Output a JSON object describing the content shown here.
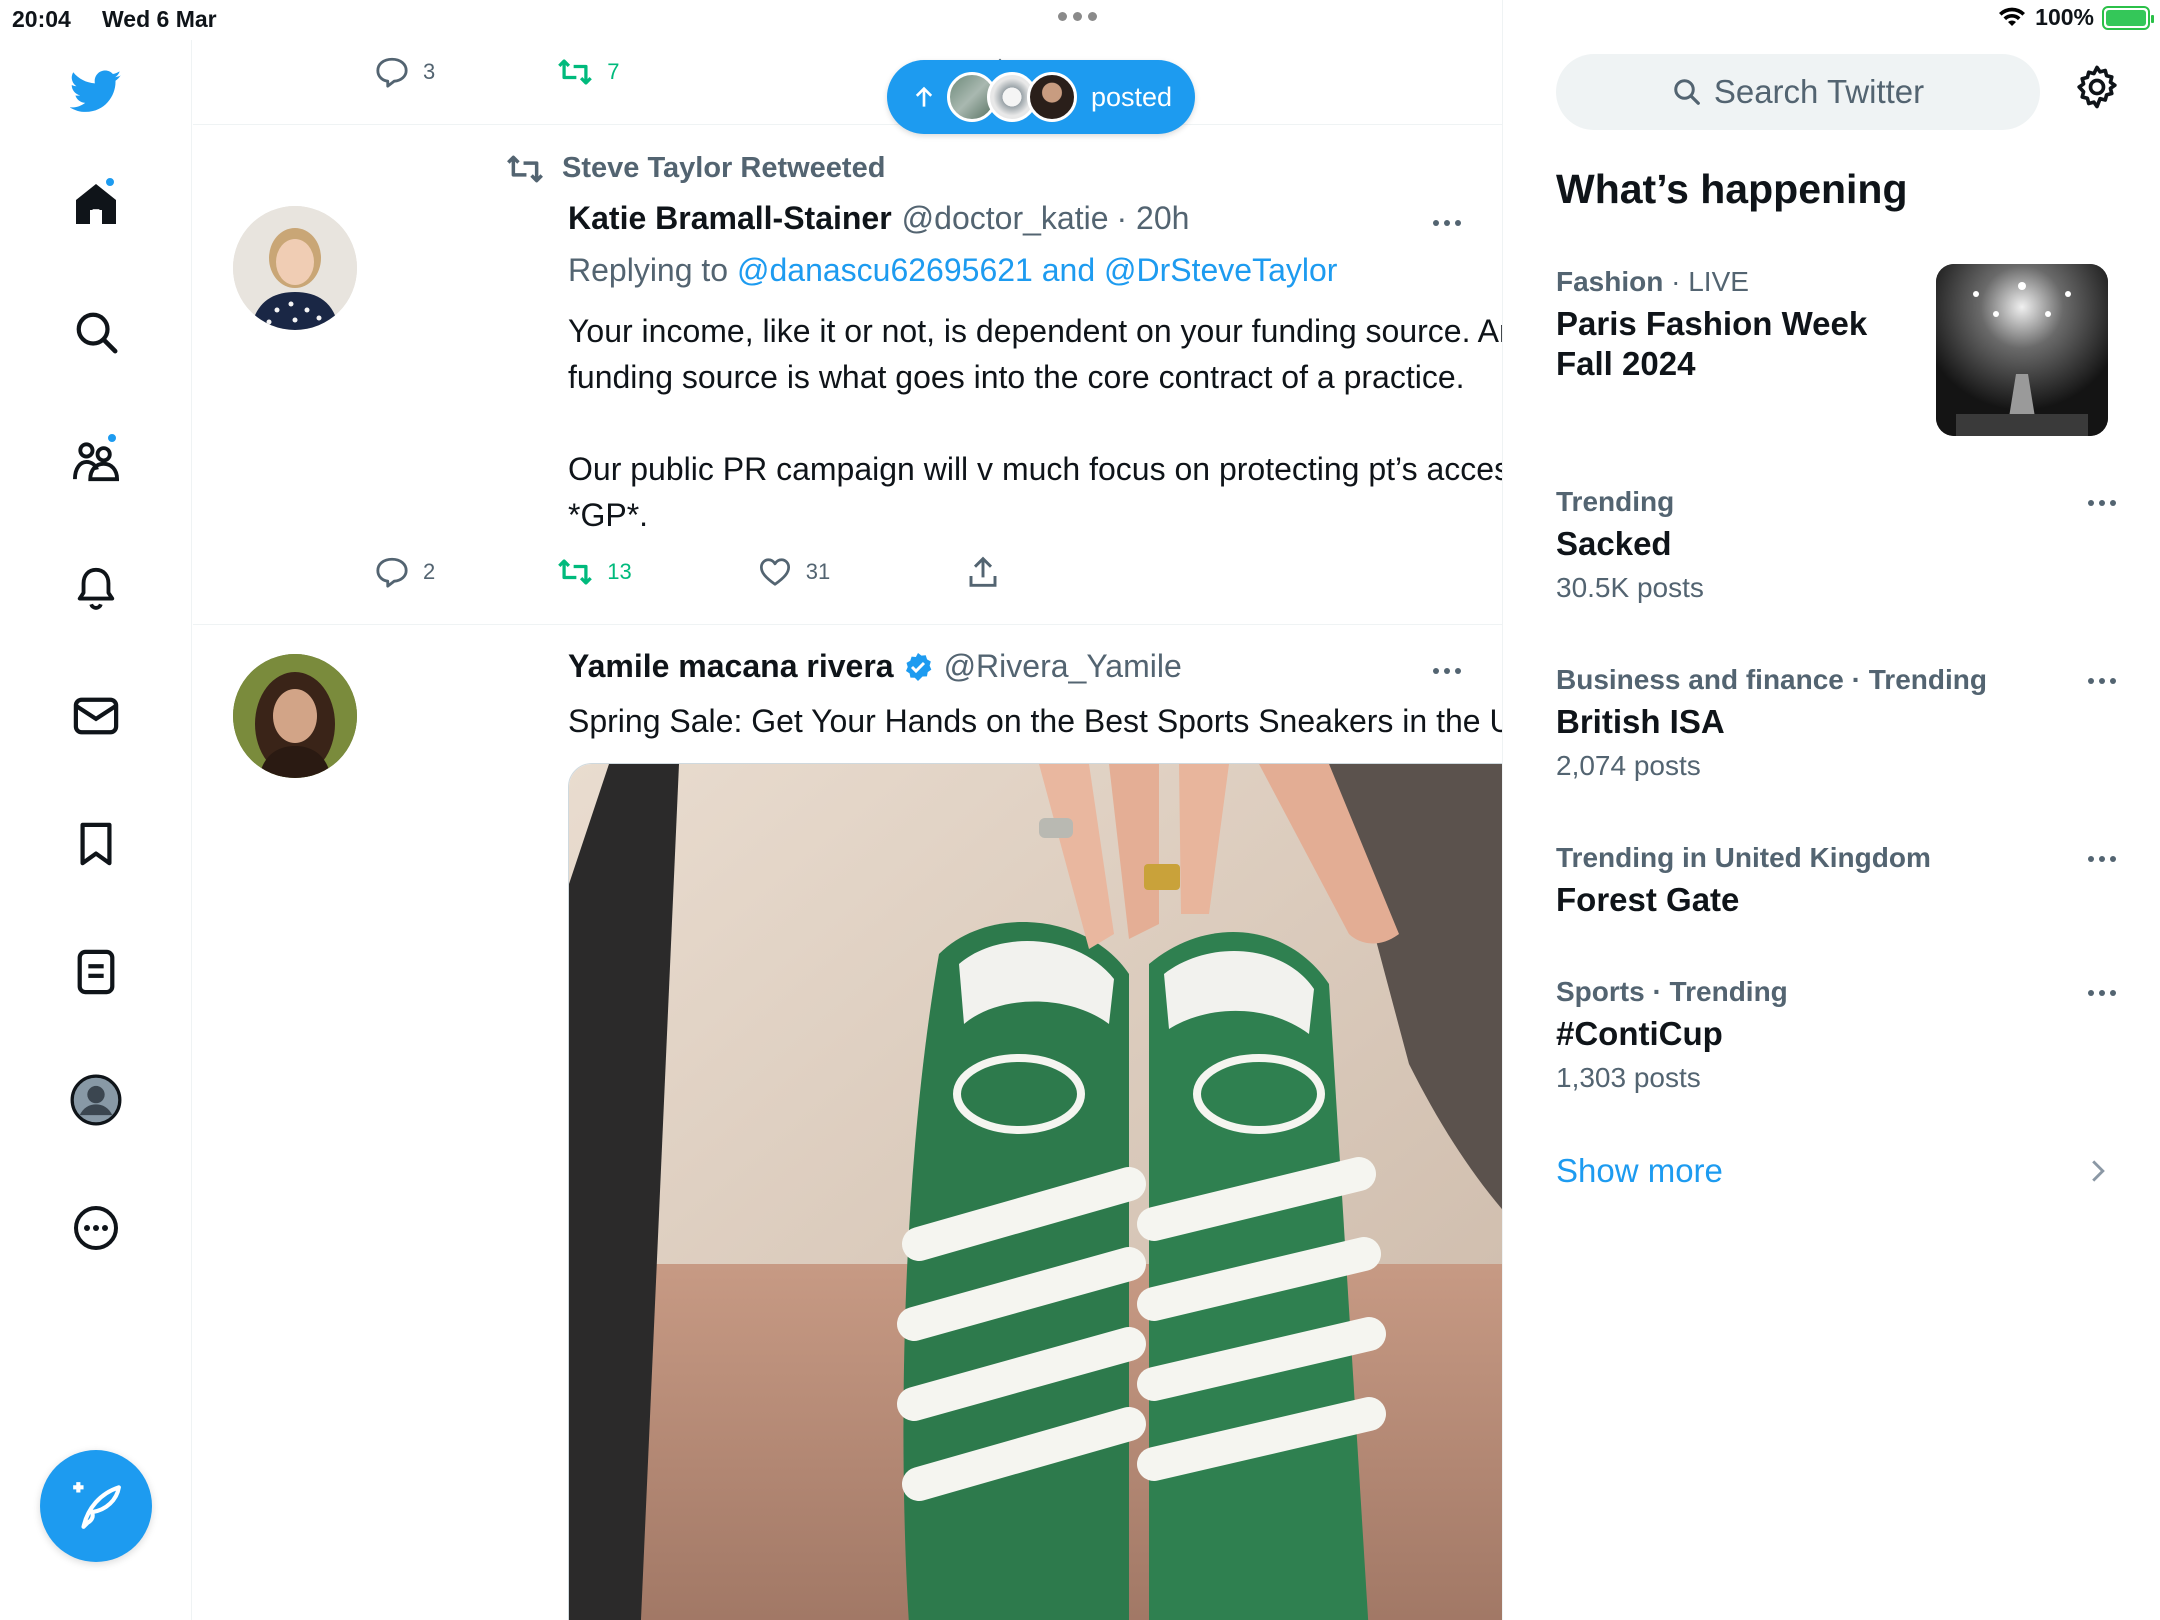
{
  "status_bar": {
    "time": "20:04",
    "date": "Wed 6 Mar",
    "battery": "100%"
  },
  "nav": {
    "items": [
      "twitter-logo",
      "home",
      "explore",
      "communities",
      "notifications",
      "messages",
      "bookmarks",
      "lists",
      "profile",
      "more"
    ],
    "compose_label": "Post"
  },
  "new_posts_pill": {
    "label": "posted"
  },
  "prev_tweet_actions": {
    "replies": "3",
    "retweets": "7"
  },
  "tweet1": {
    "social_context": "Steve Taylor Retweeted",
    "name": "Katie Bramall-Stainer",
    "handle": "@doctor_katie",
    "time": "· 20h",
    "replying_prefix": "Replying to",
    "replying_links": "@danascu62695621 and @DrSteveTaylor",
    "body_p1": "Your income, like it or not, is dependent on your funding source. And your funding source is what goes into the core contract of a practice.",
    "body_p2": "Our public PR campaign will v much focus on protecting pt’s access to a *GP*.",
    "replies": "2",
    "retweets": "13",
    "likes": "31"
  },
  "tweet2": {
    "name": "Yamile macana rivera",
    "handle": "@Rivera_Yamile",
    "verified": true,
    "body": "Spring Sale: Get Your Hands on the Best Sports Sneakers in the UK"
  },
  "sidebar": {
    "search_placeholder": "Search Twitter",
    "title": "What’s happening",
    "featured": {
      "category": "Fashion",
      "live": "· LIVE",
      "topic": "Paris Fashion Week Fall 2024"
    },
    "trends": [
      {
        "meta": "Trending",
        "topic": "Sacked",
        "count": "30.5K posts"
      },
      {
        "meta": "Business and finance · Trending",
        "topic": "British ISA",
        "count": "2,074 posts"
      },
      {
        "meta": "Trending in United Kingdom",
        "topic": "Forest Gate",
        "count": ""
      },
      {
        "meta": "Sports · Trending",
        "topic": "#ContiCup",
        "count": "1,303 posts"
      }
    ],
    "show_more": "Show more"
  },
  "colors": {
    "accent": "#1d9bf0",
    "retweet": "#00ba7c",
    "muted": "#536471",
    "text": "#0f1419"
  }
}
